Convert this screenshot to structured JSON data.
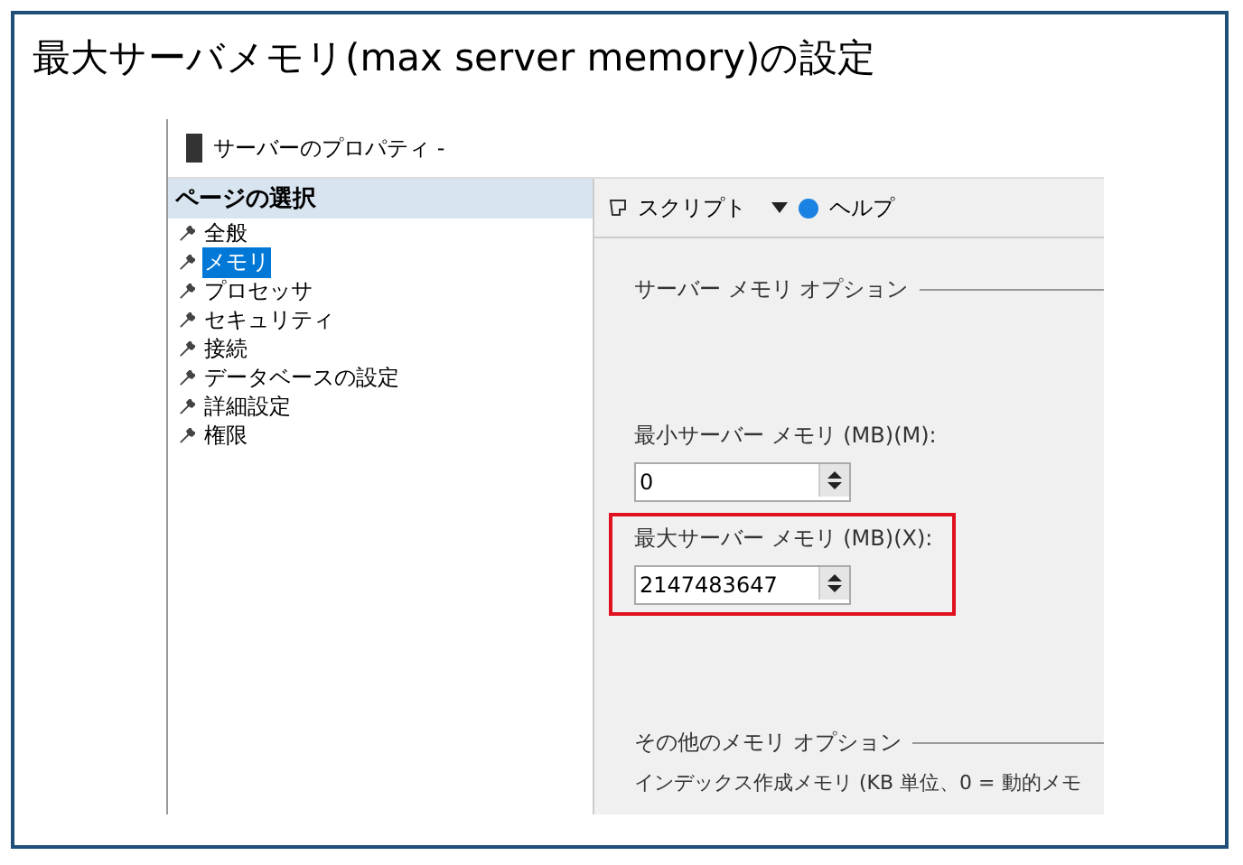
{
  "heading": "最大サーバメモリ(max server memory)の設定",
  "window": {
    "title": "サーバーのプロパティ -"
  },
  "sidebar": {
    "title": "ページの選択",
    "items": [
      {
        "label": "全般",
        "selected": false
      },
      {
        "label": "メモリ",
        "selected": true
      },
      {
        "label": "プロセッサ",
        "selected": false
      },
      {
        "label": "セキュリティ",
        "selected": false
      },
      {
        "label": "接続",
        "selected": false
      },
      {
        "label": "データベースの設定",
        "selected": false
      },
      {
        "label": "詳細設定",
        "selected": false
      },
      {
        "label": "権限",
        "selected": false
      }
    ]
  },
  "toolbar": {
    "script": "スクリプト",
    "help": "ヘルプ"
  },
  "server_memory": {
    "title": "サーバー メモリ オプション",
    "fields": [
      {
        "label": "最小サーバー メモリ (MB)(M):",
        "value": "0",
        "highlighted": false
      },
      {
        "label": "最大サーバー メモリ (MB)(X):",
        "value": "2147483647",
        "highlighted": true
      }
    ]
  },
  "other_memory": {
    "title": "その他のメモリ オプション",
    "text": "インデックス作成メモリ (KB 単位、0 = 動的メモ"
  }
}
